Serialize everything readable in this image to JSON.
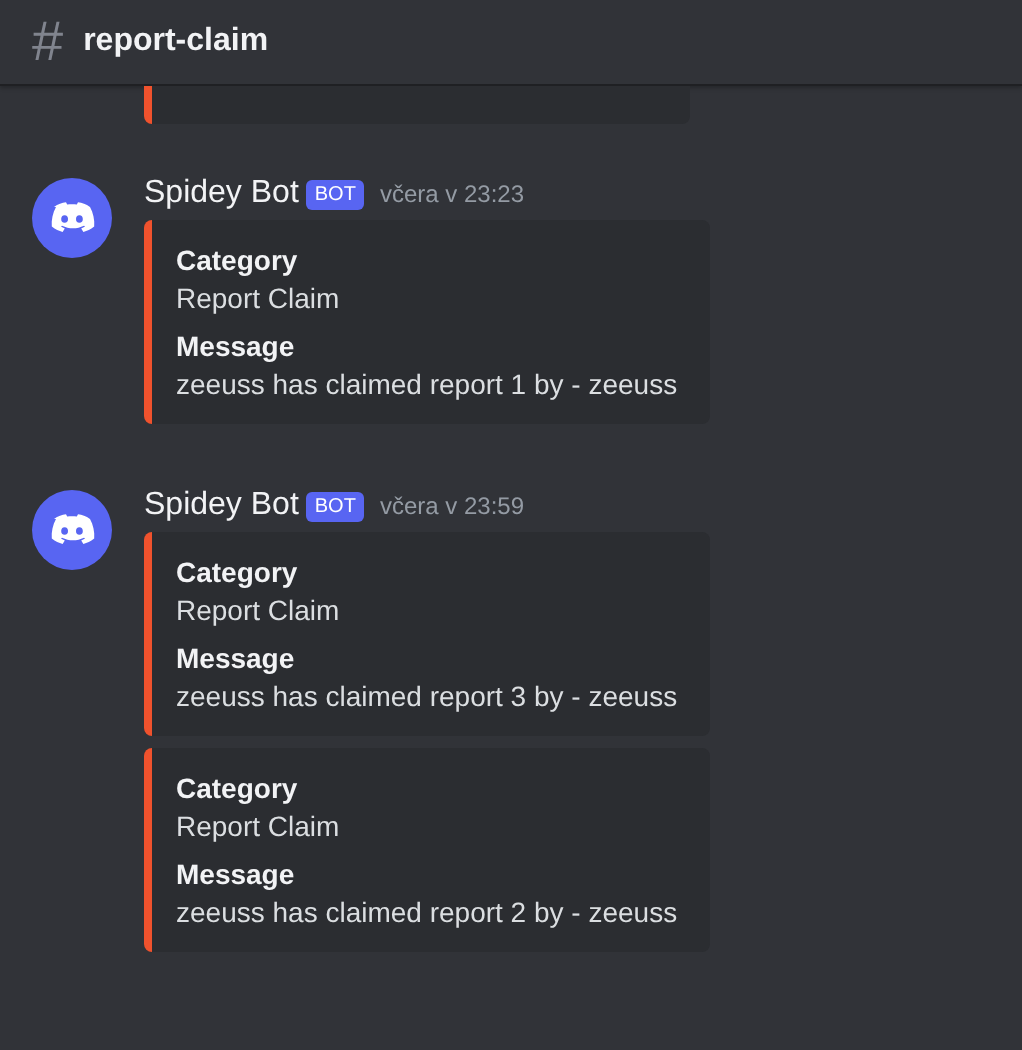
{
  "channel": {
    "icon": "#",
    "name": "report-claim"
  },
  "messages": [
    {
      "author": "Spidey Bot",
      "tag": "BOT",
      "time": "včera v 23:23",
      "embeds": [
        {
          "fields": [
            {
              "name": "Category",
              "value": "Report Claim"
            },
            {
              "name": "Message",
              "value": "zeeuss has claimed report 1 by - zeeuss"
            }
          ]
        }
      ]
    },
    {
      "author": "Spidey Bot",
      "tag": "BOT",
      "time": "včera v 23:59",
      "embeds": [
        {
          "fields": [
            {
              "name": "Category",
              "value": "Report Claim"
            },
            {
              "name": "Message",
              "value": "zeeuss has claimed report 3 by - zeeuss"
            }
          ]
        },
        {
          "fields": [
            {
              "name": "Category",
              "value": "Report Claim"
            },
            {
              "name": "Message",
              "value": "zeeuss has claimed report 2 by - zeeuss"
            }
          ]
        }
      ]
    }
  ]
}
